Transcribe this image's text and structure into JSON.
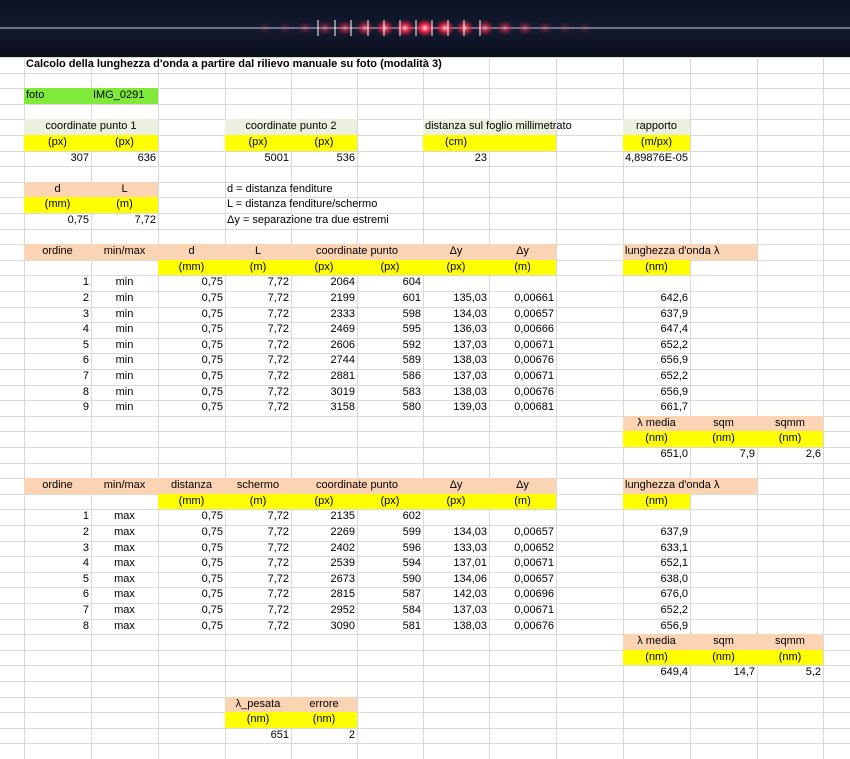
{
  "colors": {
    "green": "#7fea3a",
    "lightgreen": "#ebf1de",
    "yellow": "#ffff00",
    "peach": "#fbd4b4",
    "orange": "#f8cbad"
  },
  "title": "Calcolo della lunghezza d'onda a partire dal rilievo manuale su foto (modalità 3)",
  "foto": {
    "label": "foto",
    "value": "IMG_0291"
  },
  "coord1": {
    "header": "coordinate punto 1",
    "unit1": "(px)",
    "unit2": "(px)",
    "v1": "307",
    "v2": "636"
  },
  "coord2": {
    "header": "coordinate punto 2",
    "unit1": "(px)",
    "unit2": "(px)",
    "v1": "5001",
    "v2": "536"
  },
  "dist": {
    "header": "distanza sul foglio millimetrato",
    "unit": "(cm)",
    "value": "23"
  },
  "rapporto": {
    "header": "rapporto",
    "unit": "(m/px)",
    "value": "4,89876E-05"
  },
  "dL": {
    "d": "d",
    "L": "L",
    "unit_d": "(mm)",
    "unit_L": "(m)",
    "val_d": "0,75",
    "val_L": "7,72"
  },
  "notes": [
    "d = distanza fenditure",
    "L = distanza fenditure/schermo",
    "Δy = separazione tra due estremi"
  ],
  "table1": {
    "headers": [
      "ordine",
      "min/max",
      "d",
      "L",
      "coordinate punto",
      "Δy",
      "Δy",
      "lunghezza d'onda λ"
    ],
    "units": [
      "(mm)",
      "(m)",
      "(px)",
      "(px)",
      "(px)",
      "(m)",
      "(nm)"
    ],
    "rows": [
      [
        "1",
        "min",
        "0,75",
        "7,72",
        "2064",
        "604",
        "",
        "",
        ""
      ],
      [
        "2",
        "min",
        "0,75",
        "7,72",
        "2199",
        "601",
        "135,03",
        "0,00661",
        "642,6"
      ],
      [
        "3",
        "min",
        "0,75",
        "7,72",
        "2333",
        "598",
        "134,03",
        "0,00657",
        "637,9"
      ],
      [
        "4",
        "min",
        "0,75",
        "7,72",
        "2469",
        "595",
        "136,03",
        "0,00666",
        "647,4"
      ],
      [
        "5",
        "min",
        "0,75",
        "7,72",
        "2606",
        "592",
        "137,03",
        "0,00671",
        "652,2"
      ],
      [
        "6",
        "min",
        "0,75",
        "7,72",
        "2744",
        "589",
        "138,03",
        "0,00676",
        "656,9"
      ],
      [
        "7",
        "min",
        "0,75",
        "7,72",
        "2881",
        "586",
        "137,03",
        "0,00671",
        "652,2"
      ],
      [
        "8",
        "min",
        "0,75",
        "7,72",
        "3019",
        "583",
        "138,03",
        "0,00676",
        "656,9"
      ],
      [
        "9",
        "min",
        "0,75",
        "7,72",
        "3158",
        "580",
        "139,03",
        "0,00681",
        "661,7"
      ]
    ],
    "stats": {
      "h1": "λ media",
      "h2": "sqm",
      "h3": "sqmm",
      "u1": "(nm)",
      "u2": "(nm)",
      "u3": "(nm)",
      "v1": "651,0",
      "v2": "7,9",
      "v3": "2,6"
    }
  },
  "table2": {
    "headers": [
      "ordine",
      "min/max",
      "distanza",
      "schermo",
      "coordinate punto",
      "Δy",
      "Δy",
      "lunghezza d'onda λ"
    ],
    "units": [
      "(mm)",
      "(m)",
      "(px)",
      "(px)",
      "(px)",
      "(m)",
      "(nm)"
    ],
    "rows": [
      [
        "1",
        "max",
        "0,75",
        "7,72",
        "2135",
        "602",
        "",
        "",
        ""
      ],
      [
        "2",
        "max",
        "0,75",
        "7,72",
        "2269",
        "599",
        "134,03",
        "0,00657",
        "637,9"
      ],
      [
        "3",
        "max",
        "0,75",
        "7,72",
        "2402",
        "596",
        "133,03",
        "0,00652",
        "633,1"
      ],
      [
        "4",
        "max",
        "0,75",
        "7,72",
        "2539",
        "594",
        "137,01",
        "0,00671",
        "652,1"
      ],
      [
        "5",
        "max",
        "0,75",
        "7,72",
        "2673",
        "590",
        "134,06",
        "0,00657",
        "638,0"
      ],
      [
        "6",
        "max",
        "0,75",
        "7,72",
        "2815",
        "587",
        "142,03",
        "0,00696",
        "676,0"
      ],
      [
        "7",
        "max",
        "0,75",
        "7,72",
        "2952",
        "584",
        "137,03",
        "0,00671",
        "652,2"
      ],
      [
        "8",
        "max",
        "0,75",
        "7,72",
        "3090",
        "581",
        "138,03",
        "0,00676",
        "656,9"
      ]
    ],
    "stats": {
      "h1": "λ media",
      "h2": "sqm",
      "h3": "sqmm",
      "u1": "(nm)",
      "u2": "(nm)",
      "u3": "(nm)",
      "v1": "649,4",
      "v2": "14,7",
      "v3": "5,2"
    }
  },
  "pesata": {
    "h1": "λ_pesata",
    "h2": "errore",
    "u1": "(nm)",
    "u2": "(nm)",
    "v1": "651",
    "v2": "2"
  }
}
